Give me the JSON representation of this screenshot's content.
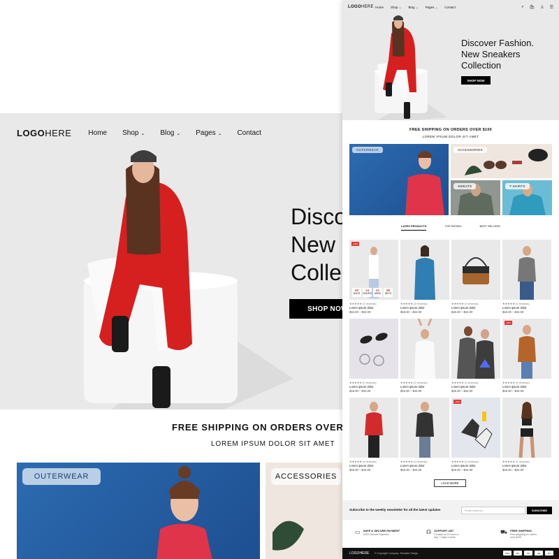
{
  "back_page": {
    "logo": {
      "bold": "LOGO",
      "light": "HERE"
    },
    "nav": [
      {
        "label": "Home",
        "caret": ""
      },
      {
        "label": "Shop",
        "caret": "⌄"
      },
      {
        "label": "Blog",
        "caret": "⌄"
      },
      {
        "label": "Pages",
        "caret": "⌄"
      },
      {
        "label": "Contact",
        "caret": ""
      }
    ],
    "headline": "Disco\nNew\nColle",
    "cta": "SHOP NOW",
    "shipping": "FREE SHIPPING ON ORDERS OVER &",
    "subline": "LOREM IPSUM DOLOR SIT AMET",
    "categories": {
      "outerwear": "OUTERWEAR",
      "accessories": "ACCESSORIES"
    }
  },
  "front_page": {
    "logo": {
      "bold": "LOGO",
      "light": "HERE"
    },
    "nav": [
      "Home",
      "Shop ⌄",
      "Blog ⌄",
      "Pages ⌄",
      "Contact"
    ],
    "icons": [
      "search-icon",
      "bag-icon",
      "user-icon",
      "menu-icon"
    ],
    "icon_glyphs": [
      "⌕",
      "🛍",
      "♙",
      "☰"
    ],
    "headline": "Discover Fashion.\nNew Sneakers\nCollection",
    "cta": "SHOP NOW",
    "shipping": "FREE SHIPPING ON ORDERS OVER $100",
    "subline": "LOREM IPSUM DOLOR SIT AMET",
    "categories": {
      "outerwear": "OUTERWEAR",
      "accessories": "ACCESSORIES",
      "sweats": "SWEATS",
      "tshirts": "T-SHIRTS"
    },
    "tabs": [
      "LATES PRODUCTS",
      "TOP RATING",
      "BEST SELLERS"
    ],
    "products": [
      {
        "name": "Lorem ipsum dolor",
        "price": "$18.30 – $44.00",
        "stars": "★★★★★ (0 reviews)",
        "sale": "-18%",
        "timer": [
          {
            "n": "50",
            "u": "DAYS"
          },
          {
            "n": "14",
            "u": "HOURS"
          },
          {
            "n": "31",
            "u": "MINS"
          },
          {
            "n": "58",
            "u": "SECS"
          }
        ]
      },
      {
        "name": "Lorem ipsum dolor",
        "price": "$18.30 – $44.00",
        "stars": "★★★★★ (0 reviews)",
        "sale": ""
      },
      {
        "name": "Lorem ipsum dolor",
        "price": "$18.30 – $44.00",
        "stars": "★★★★★ (0 reviews)",
        "sale": ""
      },
      {
        "name": "Lorem ipsum dolor",
        "price": "$18.30 – $44.00",
        "stars": "★★★★★ (0 reviews)",
        "sale": ""
      },
      {
        "name": "Lorem ipsum dolor",
        "price": "$18.30 – $44.00",
        "stars": "★★★★★ (0 reviews)",
        "sale": ""
      },
      {
        "name": "Lorem ipsum dolor",
        "price": "$18.30 – $44.00",
        "stars": "★★★★★ (0 reviews)",
        "sale": ""
      },
      {
        "name": "Lorem ipsum dolor",
        "price": "$18.30 – $44.00",
        "stars": "★★★★★ (0 reviews)",
        "sale": ""
      },
      {
        "name": "Lorem ipsum dolor",
        "price": "$18.30 – $44.00",
        "stars": "★★★★★ (0 reviews)",
        "sale": "-18%"
      },
      {
        "name": "Lorem ipsum dolor",
        "price": "$18.30 – $44.00",
        "stars": "★★★★★ (0 reviews)",
        "sale": ""
      },
      {
        "name": "Lorem ipsum dolor",
        "price": "$18.30 – $44.00",
        "stars": "★★★★★ (0 reviews)",
        "sale": ""
      },
      {
        "name": "Lorem ipsum dolor",
        "price": "$18.30 – $44.00",
        "stars": "★★★★★ (0 reviews)",
        "sale": "-18%"
      },
      {
        "name": "Lorem ipsum dolor",
        "price": "$18.30 – $44.00",
        "stars": "★★★★★ (0 reviews)",
        "sale": ""
      }
    ],
    "load_more": "LOAD MORE",
    "newsletter": {
      "text": "Subscribe to the weekly newsletter for all the latest updates",
      "placeholder": "Email Address",
      "button": "SUBSCRIBE"
    },
    "features": [
      {
        "icon": "payment-icon",
        "glyph": "▭",
        "title": "SAFE & SECURE PAYMENT",
        "sub": "100% Secure Payment"
      },
      {
        "icon": "headset-icon",
        "glyph": "☊",
        "title": "SUPPORT 24/7",
        "sub": "Contact us 24 hours a day, 7 days a week"
      },
      {
        "icon": "truck-icon",
        "glyph": "⛟",
        "title": "FREE SHIPPING",
        "sub": "Free shipping on orders over $100"
      }
    ],
    "footer": {
      "logo": "LOGOHERE",
      "copyright": "© Copyright Company. Teamsite Design",
      "payments": [
        "VISA",
        "MC",
        "PP",
        "AE",
        "DS"
      ]
    }
  }
}
